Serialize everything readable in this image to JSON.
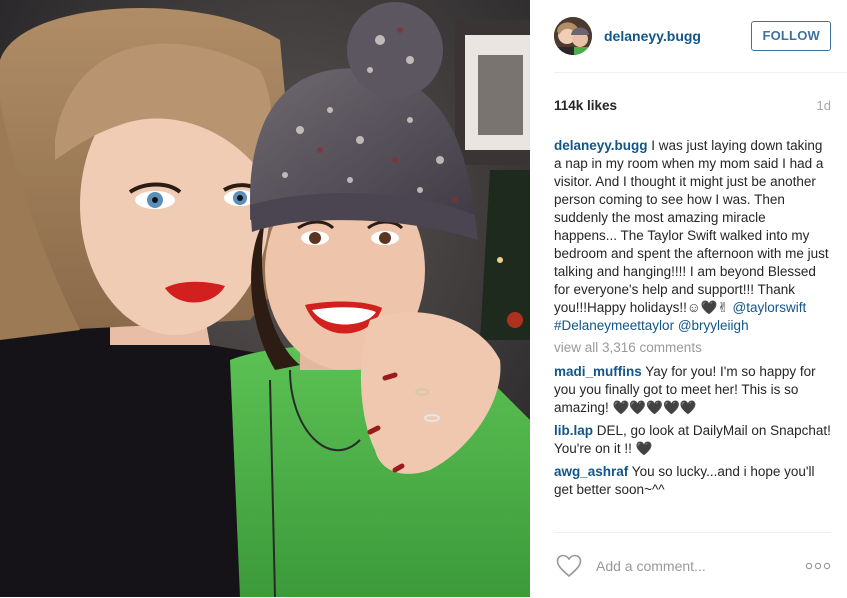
{
  "header": {
    "username": "delaneyy.bugg",
    "follow_label": "FOLLOW"
  },
  "stats": {
    "likes": "114k likes",
    "age": "1d"
  },
  "caption": {
    "username": "delaneyy.bugg",
    "text": " I was just laying down taking a nap in my room when my mom said I had a visitor. And I thought it might just be another person coming to see how I was. Then suddenly the most amazing miracle happens... The Taylor Swift walked into my bedroom and spent the afternoon with me just talking and hanging!!!! I am beyond Blessed for everyone's help and support!!! Thank you!!!Happy holidays!!☺🖤✌ ",
    "mention1": "@taylorswift",
    "hashtag": "#Delaneymeettaylor",
    "mention2": "@bryyleiigh"
  },
  "view_all": "view all 3,316 comments",
  "comments": [
    {
      "username": "madi_muffins",
      "text": " Yay for you! I'm so happy for you you finally got to meet her! This is so amazing! 🖤🖤🖤🖤🖤"
    },
    {
      "username": "lib.lap",
      "text": " DEL, go look at DailyMail on Snapchat! You're on it !! 🖤"
    },
    {
      "username": "awg_ashraf",
      "text": " You so lucky...and i hope you'll get better soon~^^"
    }
  ],
  "footer": {
    "comment_placeholder": "Add a comment..."
  },
  "colors": {
    "link": "#125688",
    "follow": "#3f729b",
    "muted": "#999999"
  },
  "icons": {
    "like": "heart-outline-icon",
    "options": "more-dots-icon"
  }
}
